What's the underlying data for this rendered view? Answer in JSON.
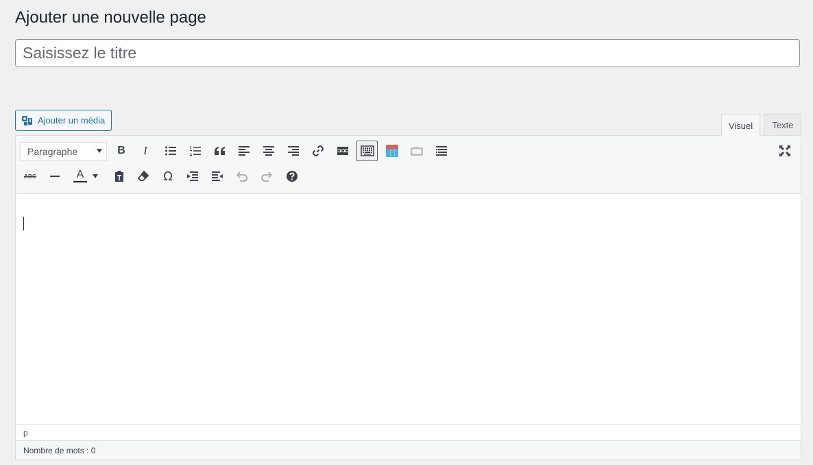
{
  "header": {
    "title": "Ajouter une nouvelle page"
  },
  "title_input": {
    "placeholder": "Saisissez le titre",
    "value": ""
  },
  "media_button": {
    "label": "Ajouter un média",
    "icon": "media-icon"
  },
  "tabs": [
    {
      "label": "Visuel",
      "active": true
    },
    {
      "label": "Texte",
      "active": false
    }
  ],
  "toolbar": {
    "format_select": {
      "value": "Paragraphe"
    },
    "row1": [
      "bold",
      "italic",
      "bullet-list",
      "numbered-list",
      "blockquote",
      "align-left",
      "align-center",
      "align-right",
      "link",
      "read-more",
      "toolbar-toggle",
      "table",
      "insert-media",
      "list-options",
      "fullscreen"
    ],
    "row2": [
      "strikethrough",
      "horizontal-line",
      "text-color",
      "paste-as-text",
      "clear-formatting",
      "special-character",
      "outdent",
      "indent",
      "undo",
      "redo",
      "help"
    ],
    "bold_glyph": "B",
    "italic_glyph": "I",
    "text_color_glyph": "A",
    "omega_glyph": "Ω",
    "strike_glyph": "ABC"
  },
  "editor": {
    "content": ""
  },
  "path_bar": {
    "path": "p"
  },
  "status_bar": {
    "word_count": "Nombre de mots : 0"
  },
  "colors": {
    "accent": "#2271b1",
    "border": "#dcdcde",
    "background": "#f0f0f1"
  }
}
